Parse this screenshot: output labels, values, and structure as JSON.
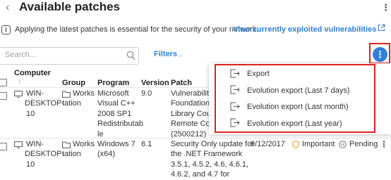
{
  "header": {
    "title": "Available patches"
  },
  "info_bar": {
    "text": "Applying the latest patches is essential for the security of your network.",
    "link": "View currently exploited vulnerabilities"
  },
  "toolbar": {
    "search_placeholder": "Search...",
    "filters_label": "Filters"
  },
  "table": {
    "columns": {
      "computer": "Computer",
      "sort_arrow": "↑",
      "group": "Group",
      "program": "Program",
      "version": "Version",
      "patch": "Patch"
    },
    "rows": [
      {
        "computer": [
          "WIN-",
          "DESKTOP-",
          "10"
        ],
        "group": [
          "Works",
          "tation"
        ],
        "program": [
          "Microsoft",
          "Visual C++",
          "2008 SP1",
          "Redistributab",
          "le"
        ],
        "version": "9.0",
        "patch": [
          "Vulnerability",
          "Foundation (",
          "Library Coulc",
          "Remote Code",
          "(2500212)"
        ]
      },
      {
        "computer": [
          "WIN-",
          "DESKTOP-",
          "10"
        ],
        "group": [
          "Works",
          "tation"
        ],
        "program": [
          "Windows 7",
          "(x64)"
        ],
        "version": "6.1",
        "patch": [
          "Security Only update for",
          "the .NET Framework",
          "3.5.1, 4.5.2, 4.6, 4.6.1,",
          "4.6.2, and 4.7 for"
        ],
        "date": "9/12/2017",
        "criticality": "Important",
        "status": "Pending"
      }
    ]
  },
  "actions_menu": {
    "items": [
      {
        "label": "Export"
      },
      {
        "label": "Evolution export (Last 7 days)"
      },
      {
        "label": "Evolution export (Last month)"
      },
      {
        "label": "Evolution export (Last year)"
      }
    ]
  },
  "colors": {
    "accent": "#2f7fd8",
    "highlight": "#e02020",
    "warning": "#f0a030"
  }
}
